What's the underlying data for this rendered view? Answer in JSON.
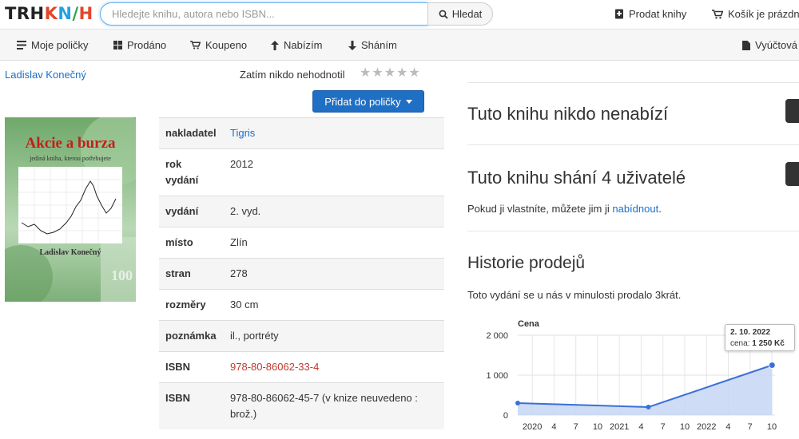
{
  "logo": {
    "p1": "TRH",
    "p2": "K",
    "p3": "N",
    "p4": "/",
    "p5": "H"
  },
  "search": {
    "placeholder": "Hledejte knihu, autora nebo ISBN...",
    "button": "Hledat"
  },
  "top_links": {
    "sell": "Prodat knihy",
    "cart": "Košík je prázdn"
  },
  "nav": {
    "items": [
      "Moje poličky",
      "Prodáno",
      "Koupeno",
      "Nabízím",
      "Sháním",
      "Vyúčtová"
    ]
  },
  "book": {
    "author": "Ladislav Konečný",
    "rating_text": "Zatím nikdo nehodnotil",
    "stars": 0,
    "add_button": "Přidat do poličky",
    "cover": {
      "title": "Akcie a burza",
      "subtitle": "jediná kniha, kterou potřebujete",
      "author": "Ladislav Konečný",
      "number": "100"
    }
  },
  "info_rows": [
    {
      "key": "nakladatel",
      "value": "Tigris",
      "style": "link"
    },
    {
      "key": "rok vydání",
      "value": "2012",
      "style": "plain"
    },
    {
      "key": "vydání",
      "value": "2. vyd.",
      "style": "plain"
    },
    {
      "key": "místo",
      "value": "Zlín",
      "style": "plain"
    },
    {
      "key": "stran",
      "value": "278",
      "style": "plain"
    },
    {
      "key": "rozměry",
      "value": "30 cm",
      "style": "plain"
    },
    {
      "key": "poznámka",
      "value": "il., portréty",
      "style": "plain"
    },
    {
      "key": "ISBN",
      "value": "978-80-86062-33-4",
      "style": "red"
    },
    {
      "key": "ISBN",
      "value": "978-80-86062-45-7 (v knize neuvedeno : brož.)",
      "style": "plain"
    }
  ],
  "offers": {
    "none_heading": "Tuto knihu nikdo nenabízí",
    "wanted_heading": "Tuto knihu shání 4 uživatelé",
    "wanted_text_pre": "Pokud ji vlastníte, můžete jim ji ",
    "wanted_link": "nabídnout",
    "wanted_text_post": "."
  },
  "history": {
    "heading": "Historie prodejů",
    "text": "Toto vydání se u nás v minulosti prodalo 3krát.",
    "tooltip_date": "2. 10. 2022",
    "tooltip_label": "cena:",
    "tooltip_value": "1 250 Kč"
  },
  "chart_data": {
    "type": "area",
    "ylabel": "Cena",
    "ylim": [
      0,
      2000
    ],
    "yticks": [
      "0",
      "1 000",
      "2 000"
    ],
    "xticks": [
      "2020",
      "4",
      "7",
      "10",
      "2021",
      "4",
      "7",
      "10",
      "2022",
      "4",
      "7",
      "10"
    ],
    "points": [
      {
        "x": "2019-11",
        "y": 300
      },
      {
        "x": "2021-05",
        "y": 200
      },
      {
        "x": "2022-10-02",
        "y": 1250
      }
    ],
    "colors": {
      "line": "#3a6fd8",
      "fill": "#c6d6f3"
    }
  }
}
